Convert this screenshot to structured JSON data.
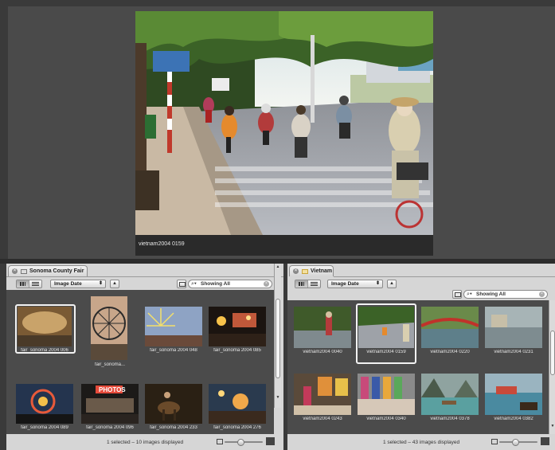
{
  "viewer": {
    "caption": "vietnam2004 0159"
  },
  "left_browser": {
    "tab_label": "Sonoma County Fair",
    "sort_label": "Image Date",
    "search_placeholder": "Showing All",
    "status": "1 selected – 10 images displayed",
    "thumbnails": [
      {
        "label": "fair_sonoma 2004 006",
        "selected": true,
        "scene": "cave"
      },
      {
        "label": "fair_sonoma...",
        "selected": false,
        "scene": "wheel"
      },
      {
        "label": "fair_sonoma 2004 048",
        "selected": false,
        "scene": "ride"
      },
      {
        "label": "fair_sonoma 2004 085",
        "selected": false,
        "scene": "night"
      },
      {
        "label": "fair_sonoma 2004 089",
        "selected": false,
        "scene": "ferris"
      },
      {
        "label": "fair_sonoma 2004 096",
        "selected": false,
        "scene": "photos"
      },
      {
        "label": "fair_sonoma 2004 233",
        "selected": false,
        "scene": "horses"
      },
      {
        "label": "fair_sonoma 2004 276",
        "selected": false,
        "scene": "lights"
      }
    ]
  },
  "right_browser": {
    "tab_label": "Vietnam",
    "sort_label": "Image Date",
    "search_placeholder": "Showing All",
    "status": "1 selected – 43 images displayed",
    "thumbnails": [
      {
        "label": "vietnam2004 0040",
        "selected": false,
        "scene": "street"
      },
      {
        "label": "vietnam2004 0159",
        "selected": true,
        "scene": "road"
      },
      {
        "label": "vietnam2004 0220",
        "selected": false,
        "scene": "bridge"
      },
      {
        "label": "vietnam2004 0231",
        "selected": false,
        "scene": "flood"
      },
      {
        "label": "vietnam2004 0243",
        "selected": false,
        "scene": "shop"
      },
      {
        "label": "vietnam2004 0340",
        "selected": false,
        "scene": "fabric"
      },
      {
        "label": "vietnam2004 0378",
        "selected": false,
        "scene": "bay"
      },
      {
        "label": "vietnam2004 0382",
        "selected": false,
        "scene": "boats"
      }
    ]
  },
  "colors": {
    "background": "#3a3a3a",
    "browser_chrome": "#d6d6d6",
    "pane": "#4b4b4b",
    "selection": "#f2f2f2"
  },
  "icons": [
    "close-icon",
    "album-icon",
    "grid-view-icon",
    "list-view-icon",
    "sort-direction-icon",
    "keyword-icon",
    "search-icon",
    "clear-search-icon",
    "thumbnail-small-icon",
    "thumbnail-large-icon"
  ]
}
